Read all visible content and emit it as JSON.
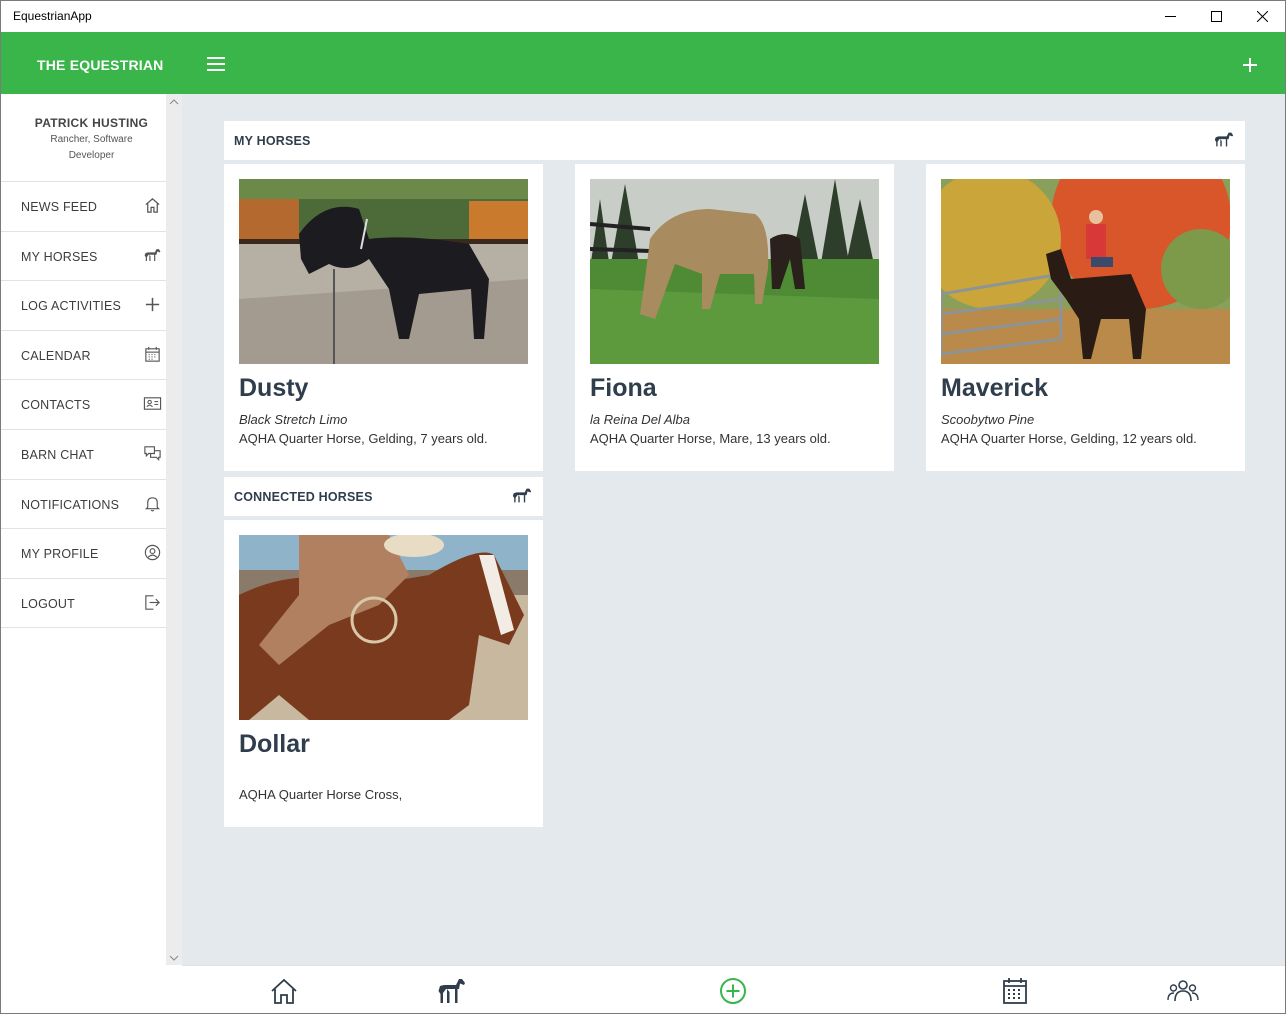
{
  "window": {
    "title": "EquestrianApp"
  },
  "header": {
    "brand": "THE EQUESTRIAN",
    "menu_icon": "hamburger-icon",
    "add_icon": "plus-icon",
    "color": "#39b54a"
  },
  "profile": {
    "name": "PATRICK HUSTING",
    "role": "Rancher, Software Developer"
  },
  "sidebar": {
    "items": [
      {
        "label": "NEWS FEED",
        "icon": "home-icon"
      },
      {
        "label": "MY HORSES",
        "icon": "horse-icon"
      },
      {
        "label": "LOG ACTIVITIES",
        "icon": "plus-icon"
      },
      {
        "label": "CALENDAR",
        "icon": "calendar-icon"
      },
      {
        "label": "CONTACTS",
        "icon": "contact-card-icon"
      },
      {
        "label": "BARN CHAT",
        "icon": "chat-icon"
      },
      {
        "label": "NOTIFICATIONS",
        "icon": "bell-icon"
      },
      {
        "label": "MY PROFILE",
        "icon": "user-circle-icon"
      },
      {
        "label": "LOGOUT",
        "icon": "logout-icon"
      }
    ]
  },
  "my_horses": {
    "title": "MY HORSES",
    "icon": "horse-icon",
    "horses": [
      {
        "name": "Dusty",
        "registered_name": "Black Stretch Limo",
        "description": "AQHA Quarter Horse, Gelding, 7 years old."
      },
      {
        "name": "Fiona",
        "registered_name": "la Reina Del Alba",
        "description": "AQHA Quarter Horse, Mare, 13 years old."
      },
      {
        "name": "Maverick",
        "registered_name": "Scoobytwo Pine",
        "description": "AQHA Quarter Horse, Gelding, 12 years old."
      }
    ]
  },
  "connected_horses": {
    "title": "CONNECTED HORSES",
    "icon": "horse-icon",
    "horses": [
      {
        "name": "Dollar",
        "registered_name": "",
        "description": "AQHA Quarter Horse Cross,"
      }
    ]
  },
  "bottom_nav": {
    "items": [
      {
        "icon": "home-icon"
      },
      {
        "icon": "horse-icon"
      },
      {
        "icon": "add-circle-icon",
        "color": "#39b54a"
      },
      {
        "icon": "calendar-icon"
      },
      {
        "icon": "group-icon"
      }
    ]
  },
  "colors": {
    "accent": "#39b54a",
    "heading_text": "#2f3d4c",
    "content_bg": "#e4e9ee"
  }
}
